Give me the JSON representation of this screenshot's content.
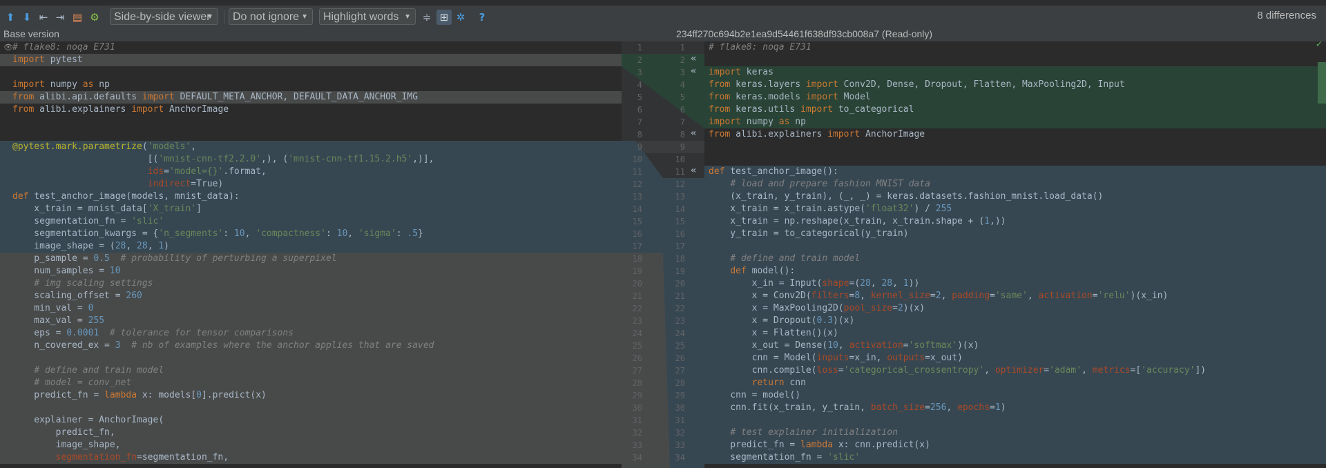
{
  "toolbar": {
    "viewer_mode": "Side-by-side viewer",
    "ignore_mode": "Do not ignore",
    "highlight_mode": "Highlight words",
    "help": "?",
    "differences": "8 differences",
    "icons": [
      "arrow-up-icon",
      "arrow-down-icon",
      "jump-left-icon",
      "jump-right-icon",
      "compare-icon",
      "settings-bolt-icon"
    ]
  },
  "headers": {
    "left": "Base version",
    "right": "234ff270c694b2e1ea9d54461f638df93cb008a7 (Read-only)"
  },
  "left_lines": [
    "# flake8: noqa E731",
    "import pytest",
    "",
    "import numpy as np",
    "from alibi.api.defaults import DEFAULT_META_ANCHOR, DEFAULT_DATA_ANCHOR_IMG",
    "from alibi.explainers import AnchorImage",
    "",
    "",
    "@pytest.mark.parametrize('models',",
    "                         [('mnist-cnn-tf2.2.0',), ('mnist-cnn-tf1.15.2.h5',)],",
    "                         ids='model={}'.format,",
    "                         indirect=True)",
    "def test_anchor_image(models, mnist_data):",
    "    x_train = mnist_data['X_train']",
    "    segmentation_fn = 'slic'",
    "    segmentation_kwargs = {'n_segments': 10, 'compactness': 10, 'sigma': .5}",
    "    image_shape = (28, 28, 1)",
    "    p_sample = 0.5  # probability of perturbing a superpixel",
    "    num_samples = 10",
    "    # img scaling settings",
    "    scaling_offset = 260",
    "    min_val = 0",
    "    max_val = 255",
    "    eps = 0.0001  # tolerance for tensor comparisons",
    "    n_covered_ex = 3  # nb of examples where the anchor applies that are saved",
    "",
    "    # define and train model",
    "    # model = conv_net",
    "    predict_fn = lambda x: models[0].predict(x)",
    "",
    "    explainer = AnchorImage(",
    "        predict_fn,",
    "        image_shape,",
    "        segmentation_fn=segmentation_fn,"
  ],
  "right_lines": [
    "# flake8: noqa E731",
    "",
    "import keras",
    "from keras.layers import Conv2D, Dense, Dropout, Flatten, MaxPooling2D, Input",
    "from keras.models import Model",
    "from keras.utils import to_categorical",
    "import numpy as np",
    "from alibi.explainers import AnchorImage",
    "",
    "",
    "def test_anchor_image():",
    "    # load and prepare fashion MNIST data",
    "    (x_train, y_train), (_, _) = keras.datasets.fashion_mnist.load_data()",
    "    x_train = x_train.astype('float32') / 255",
    "    x_train = np.reshape(x_train, x_train.shape + (1,))",
    "    y_train = to_categorical(y_train)",
    "",
    "    # define and train model",
    "    def model():",
    "        x_in = Input(shape=(28, 28, 1))",
    "        x = Conv2D(filters=8, kernel_size=2, padding='same', activation='relu')(x_in)",
    "        x = MaxPooling2D(pool_size=2)(x)",
    "        x = Dropout(0.3)(x)",
    "        x = Flatten()(x)",
    "        x_out = Dense(10, activation='softmax')(x)",
    "        cnn = Model(inputs=x_in, outputs=x_out)",
    "        cnn.compile(loss='categorical_crossentropy', optimizer='adam', metrics=['accuracy'])",
    "        return cnn",
    "    cnn = model()",
    "    cnn.fit(x_train, y_train, batch_size=256, epochs=1)",
    "",
    "    # test explainer initialization",
    "    predict_fn = lambda x: cnn.predict(x)",
    "    segmentation_fn = 'slic'"
  ],
  "left_line_numbers": [
    "1",
    "2",
    "3",
    "4",
    "5",
    "6",
    "7",
    "8",
    "9",
    "10",
    "11",
    "12",
    "13",
    "14",
    "15",
    "16",
    "17",
    "18",
    "19",
    "20",
    "21",
    "22",
    "23",
    "24",
    "25",
    "26",
    "27",
    "28",
    "29",
    "30",
    "31",
    "32",
    "33",
    "34"
  ],
  "right_line_numbers": [
    "1",
    "2",
    "3",
    "4",
    "5",
    "6",
    "7",
    "8",
    "9",
    "10",
    "11",
    "12",
    "13",
    "14",
    "15",
    "16",
    "17",
    "18",
    "19",
    "20",
    "21",
    "22",
    "23",
    "24",
    "25",
    "26",
    "27",
    "28",
    "29",
    "30",
    "31",
    "32",
    "33",
    "34"
  ],
  "merge_markers": [
    "«",
    "«",
    "«",
    "«"
  ],
  "colors": {
    "changed": "#374752",
    "deleted": "#484a4a",
    "inserted": "#294436",
    "bg": "#2b2b2b"
  }
}
